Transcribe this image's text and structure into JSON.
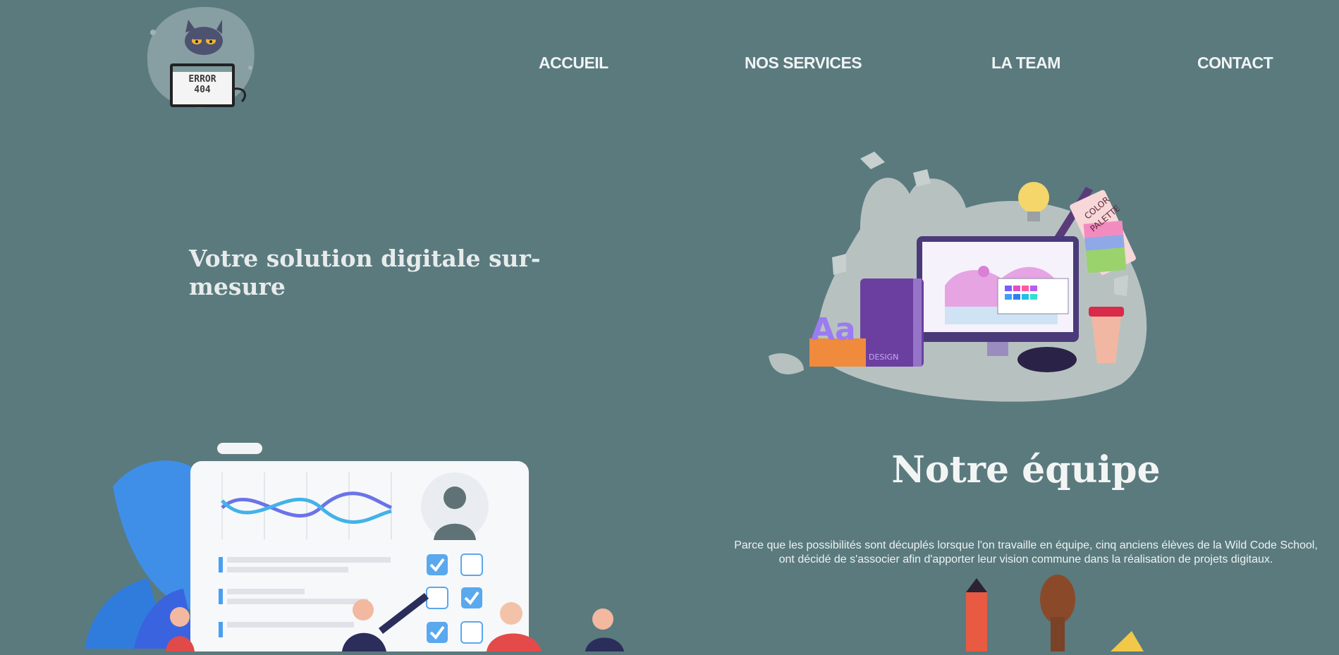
{
  "logo": {
    "line1": "ERROR",
    "line2": "404",
    "icon": "cat-error-404-logo"
  },
  "nav": {
    "items": [
      {
        "label": "ACCUEIL"
      },
      {
        "label": "NOS SERVICES"
      },
      {
        "label": "LA TEAM"
      },
      {
        "label": "CONTACT"
      }
    ]
  },
  "hero": {
    "title": "Votre solution digitale sur-mesure",
    "illustration": {
      "icon": "design-workspace-illustration",
      "book_label": "DESIGN",
      "palette_label_1": "COLOR",
      "palette_label_2": "PALETTE",
      "letters": "Aa"
    }
  },
  "team": {
    "title": "Notre équipe",
    "description": "Parce que les possibilités sont décuplés lorsque l'on travaille en équipe, cinq anciens élèves de la Wild Code School, ont décidé de s'associer afin d'apporter leur vision commune dans la réalisation de projets digitaux.",
    "illustration": {
      "icon": "team-dashboard-illustration"
    },
    "tools": {
      "icon": "art-tools-illustration"
    }
  },
  "colors": {
    "background": "#5a7a7e",
    "text": "#f1f4f4"
  }
}
